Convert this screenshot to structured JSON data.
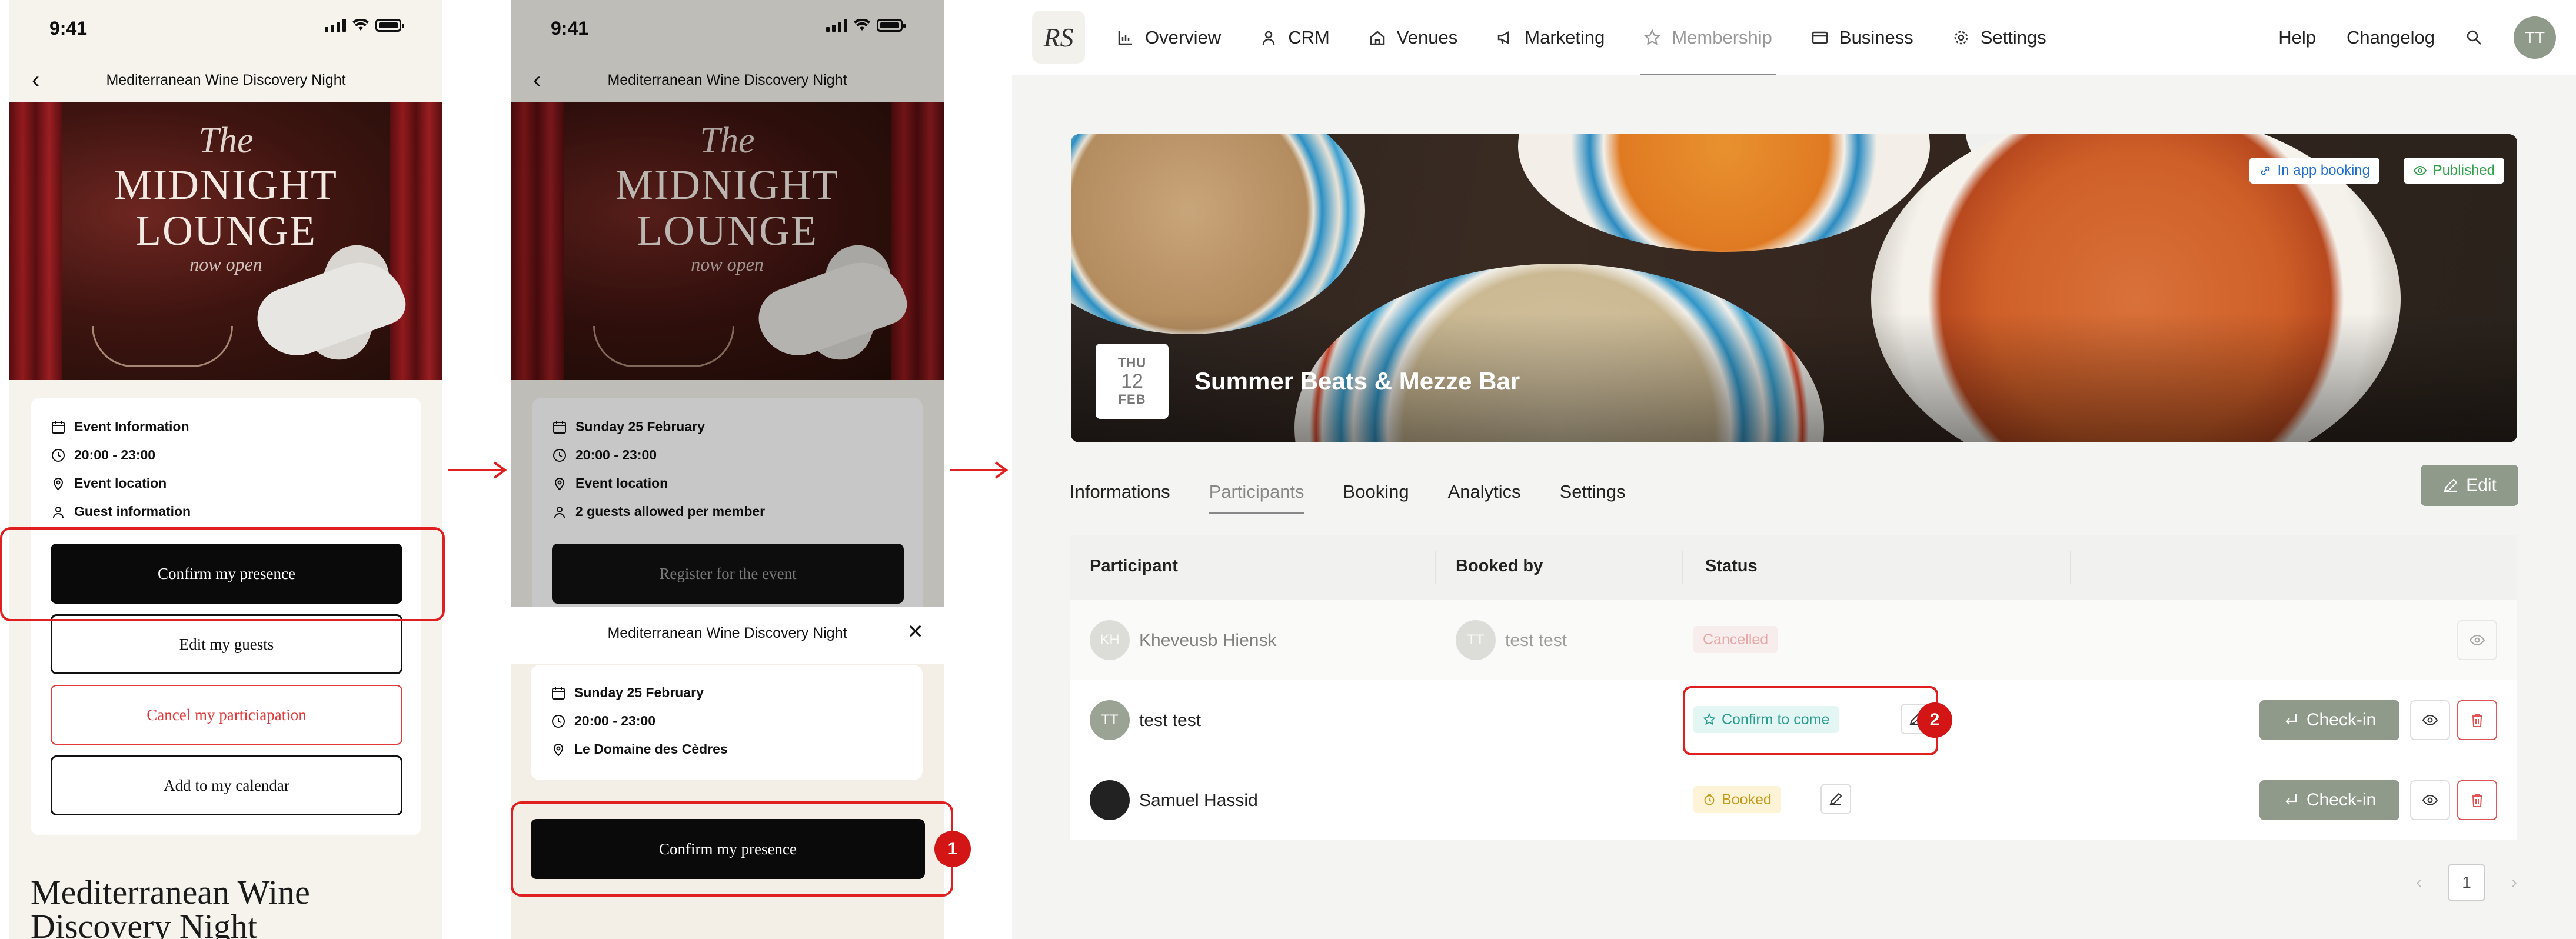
{
  "phone1": {
    "time": "9:41",
    "nav_title": "Mediterranean Wine Discovery Night",
    "hero": {
      "line1": "The",
      "line2": "MIDNIGHT",
      "line3": "LOUNGE",
      "line4": "now open"
    },
    "info": [
      "Event Information",
      "20:00 - 23:00",
      "Event location",
      "Guest information"
    ],
    "buttons": {
      "confirm": "Confirm my presence",
      "edit_guests": "Edit my guests",
      "cancel": "Cancel my particiapation",
      "calendar": "Add to my calendar"
    },
    "event_title_l1": "Mediterranean Wine",
    "event_title_l2": "Discovery Night"
  },
  "phone2": {
    "time": "9:41",
    "nav_title": "Mediterranean Wine Discovery Night",
    "hero": {
      "line1": "The",
      "line2": "MIDNIGHT",
      "line3": "LOUNGE",
      "line4": "now open"
    },
    "info": [
      "Sunday 25 February",
      "20:00 - 23:00",
      "Event location",
      "2 guests allowed per member"
    ],
    "register": "Register for the event",
    "sheet": {
      "title": "Mediterranean Wine Discovery Night",
      "info": [
        "Sunday 25 February",
        "20:00 - 23:00",
        "Le Domaine des Cèdres"
      ],
      "confirm": "Confirm my presence"
    },
    "step_badge": "1"
  },
  "desktop": {
    "logo": "RS",
    "nav": [
      "Overview",
      "CRM",
      "Venues",
      "Marketing",
      "Membership",
      "Business",
      "Settings"
    ],
    "nav_active": "Membership",
    "nav_right": {
      "help": "Help",
      "changelog": "Changelog",
      "avatar": "TT"
    },
    "banner": {
      "day": "THU",
      "date": "12",
      "month": "FEB",
      "title": "Summer Beats & Mezze Bar",
      "tag_booking": "In app booking",
      "tag_published": "Published"
    },
    "tabs": [
      "Informations",
      "Participants",
      "Booking",
      "Analytics",
      "Settings"
    ],
    "active_tab": "Participants",
    "edit": "Edit",
    "table": {
      "headers": [
        "Participant",
        "Booked by",
        "Status"
      ],
      "rows": [
        {
          "initials": "KH",
          "name": "Kheveusb Hiensk",
          "booked_initials": "TT",
          "booked_by": "test test",
          "status": "Cancelled"
        },
        {
          "initials": "TT",
          "name": "test test",
          "status": "Confirm to come",
          "action": "Check-in"
        },
        {
          "initials": "",
          "name": "Samuel Hassid",
          "status": "Booked",
          "action": "Check-in"
        }
      ]
    },
    "step_badge": "2",
    "page": "1"
  },
  "colors": {
    "highlight": "#e02020",
    "accent_sage": "#8f9a8a",
    "confirm_teal": "#2a9d8f",
    "booked_yellow": "#c69a19",
    "cancel_red": "#e06a6a"
  }
}
